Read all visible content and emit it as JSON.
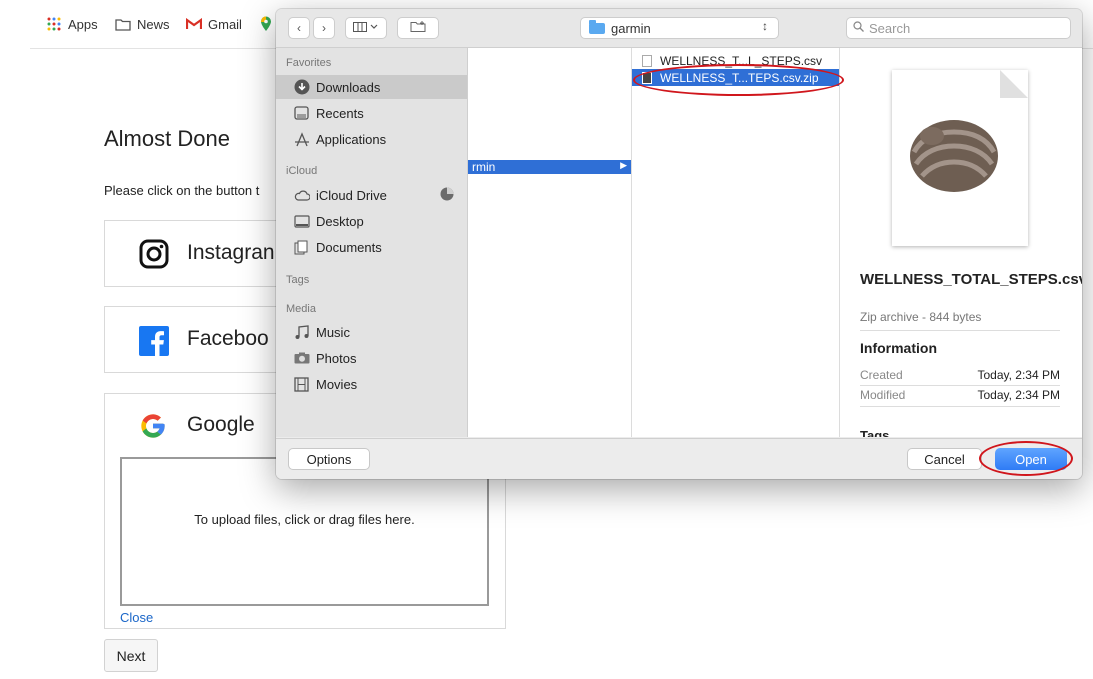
{
  "bookmarks": [
    {
      "label": "Apps",
      "icon": "apps-grid-icon"
    },
    {
      "label": "News",
      "icon": "folder-icon"
    },
    {
      "label": "Gmail",
      "icon": "gmail-icon"
    },
    {
      "label": "",
      "icon": "maps-pin-icon"
    }
  ],
  "page": {
    "title": "Almost Done",
    "description": "Please click on the button t",
    "services": [
      {
        "label": "Instagran",
        "icon": "instagram-icon"
      },
      {
        "label": "Faceboo",
        "icon": "facebook-icon"
      },
      {
        "label": "Google",
        "icon": "google-icon"
      }
    ],
    "upload_text": "To upload files, click or drag files here.",
    "close_label": "Close",
    "next_label": "Next"
  },
  "dialog": {
    "location": "garmin",
    "search_placeholder": "Search",
    "sidebar": {
      "favorites_header": "Favorites",
      "favorites": [
        {
          "label": "Downloads",
          "icon": "download-icon",
          "selected": true
        },
        {
          "label": "Recents",
          "icon": "recents-icon"
        },
        {
          "label": "Applications",
          "icon": "applications-icon"
        }
      ],
      "icloud_header": "iCloud",
      "icloud": [
        {
          "label": "iCloud Drive",
          "icon": "cloud-icon"
        },
        {
          "label": "Desktop",
          "icon": "desktop-icon"
        },
        {
          "label": "Documents",
          "icon": "documents-icon"
        }
      ],
      "tags_header": "Tags",
      "media_header": "Media",
      "media": [
        {
          "label": "Music",
          "icon": "music-icon"
        },
        {
          "label": "Photos",
          "icon": "camera-icon"
        },
        {
          "label": "Movies",
          "icon": "film-icon"
        }
      ]
    },
    "column1_folder": "rmin",
    "files": [
      {
        "name": "WELLNESS_T...L_STEPS.csv",
        "selected": false
      },
      {
        "name": "WELLNESS_T...TEPS.csv.zip",
        "selected": true
      }
    ],
    "preview": {
      "filename": "WELLNESS_TOTAL_STEPS.csv.zip",
      "meta": "Zip archive - 844 bytes",
      "info_header": "Information",
      "created_label": "Created",
      "created_value": "Today, 2:34 PM",
      "modified_label": "Modified",
      "modified_value": "Today, 2:34 PM",
      "tags_label": "Tags"
    },
    "options_label": "Options",
    "cancel_label": "Cancel",
    "open_label": "Open",
    "accent_color": "#2f6fd6",
    "annotation_color": "#d0161c"
  }
}
